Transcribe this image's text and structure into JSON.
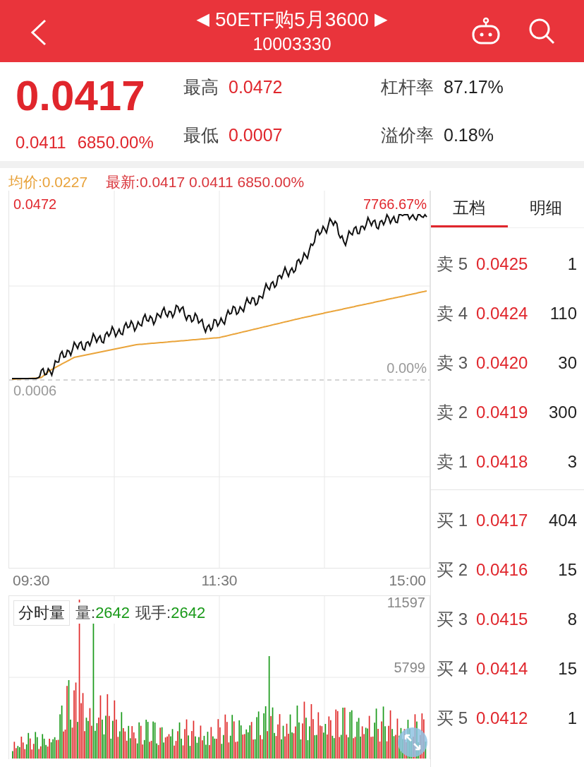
{
  "header": {
    "title": "50ETF购5月3600",
    "code": "10003330",
    "prev": "◀",
    "next": "▶"
  },
  "quote": {
    "price": "0.0417",
    "change": "0.0411",
    "change_pct": "6850.00%",
    "stats": [
      {
        "label": "最高",
        "value": "0.0472"
      },
      {
        "label": "最低",
        "value": "0.0007"
      }
    ],
    "ratios": [
      {
        "label": "杠杆率",
        "value": "87.17%"
      },
      {
        "label": "溢价率",
        "value": "0.18%"
      }
    ]
  },
  "chart": {
    "avg": "均价:0.0227",
    "latest": "最新:0.0417 0.0411 6850.00%",
    "high": "0.0472",
    "high_pct": "7766.67%",
    "low": "0.0006",
    "low_pct": "0.00%",
    "times": [
      "09:30",
      "11:30",
      "15:00"
    ]
  },
  "volume": {
    "button": "分时量",
    "vol_label": "量:",
    "vol": "2642",
    "hand_label": "现手:",
    "hand": "2642",
    "max": "11597",
    "mid": "5799"
  },
  "order_book": {
    "tabs": [
      {
        "label": "五档",
        "selected": true
      },
      {
        "label": "明细",
        "selected": false
      }
    ],
    "asks": [
      {
        "label": "卖 5",
        "price": "0.0425",
        "qty": "1"
      },
      {
        "label": "卖 4",
        "price": "0.0424",
        "qty": "110"
      },
      {
        "label": "卖 3",
        "price": "0.0420",
        "qty": "30"
      },
      {
        "label": "卖 2",
        "price": "0.0419",
        "qty": "300"
      },
      {
        "label": "卖 1",
        "price": "0.0418",
        "qty": "3"
      }
    ],
    "bids": [
      {
        "label": "买 1",
        "price": "0.0417",
        "qty": "404"
      },
      {
        "label": "买 2",
        "price": "0.0416",
        "qty": "15"
      },
      {
        "label": "买 3",
        "price": "0.0415",
        "qty": "8"
      },
      {
        "label": "买 4",
        "price": "0.0414",
        "qty": "15"
      },
      {
        "label": "买 5",
        "price": "0.0412",
        "qty": "1"
      }
    ]
  }
}
